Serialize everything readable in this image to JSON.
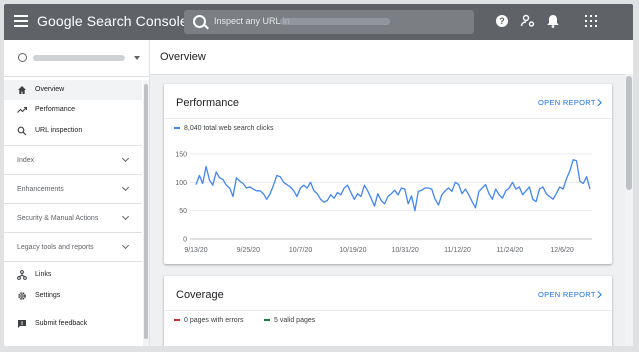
{
  "app": {
    "title": "Google Search Console"
  },
  "search": {
    "placeholder": "Inspect any URL in"
  },
  "sidebar": {
    "items": [
      {
        "label": "Overview",
        "icon": "home-icon",
        "active": true
      },
      {
        "label": "Performance",
        "icon": "trending-up-icon"
      },
      {
        "label": "URL inspection",
        "icon": "search-icon"
      }
    ],
    "sections": [
      {
        "label": "Index"
      },
      {
        "label": "Enhancements"
      },
      {
        "label": "Security & Manual Actions"
      },
      {
        "label": "Legacy tools and reports"
      }
    ],
    "bottom_items": [
      {
        "label": "Links",
        "icon": "links-icon"
      },
      {
        "label": "Settings",
        "icon": "gear-icon"
      },
      {
        "label": "Submit feedback",
        "icon": "feedback-icon"
      }
    ]
  },
  "main": {
    "page_title": "Overview",
    "performance": {
      "title": "Performance",
      "open_report": "OPEN REPORT",
      "legend": "8,040 total web search clicks",
      "accent": "#4285f4"
    },
    "coverage": {
      "title": "Coverage",
      "open_report": "OPEN REPORT",
      "errors": "0 pages with errors",
      "valid": "5 valid pages",
      "error_color": "#d93025",
      "valid_color": "#188038"
    }
  },
  "chart_data": {
    "type": "line",
    "x_ticks": [
      "9/13/20",
      "9/25/20",
      "10/7/20",
      "10/19/20",
      "10/31/20",
      "11/12/20",
      "11/24/20",
      "12/6/20"
    ],
    "y_ticks": [
      "150",
      "100",
      "50",
      "0"
    ],
    "ylim": [
      0,
      150
    ],
    "grid": true,
    "series": [
      {
        "name": "Clicks",
        "color": "#4285f4",
        "values": [
          96,
          112,
          98,
          128,
          104,
          95,
          118,
          108,
          105,
          95,
          90,
          75,
          108,
          102,
          98,
          90,
          92,
          88,
          85,
          85,
          80,
          70,
          80,
          95,
          112,
          110,
          100,
          96,
          92,
          85,
          75,
          90,
          95,
          90,
          100,
          85,
          80,
          70,
          65,
          68,
          78,
          72,
          82,
          78,
          90,
          95,
          82,
          70,
          80,
          75,
          95,
          85,
          72,
          58,
          80,
          68,
          62,
          75,
          80,
          86,
          78,
          90,
          88,
          62,
          76,
          50,
          84,
          86,
          90,
          90,
          88,
          70,
          60,
          78,
          85,
          90,
          84,
          100,
          96,
          80,
          88,
          78,
          66,
          55,
          84,
          90,
          96,
          80,
          70,
          88,
          78,
          72,
          85,
          90,
          100,
          88,
          92,
          78,
          85,
          92,
          70,
          66,
          88,
          92,
          80,
          75,
          70,
          80,
          92,
          88,
          106,
          120,
          140,
          138,
          102,
          98,
          110,
          88
        ]
      }
    ]
  }
}
